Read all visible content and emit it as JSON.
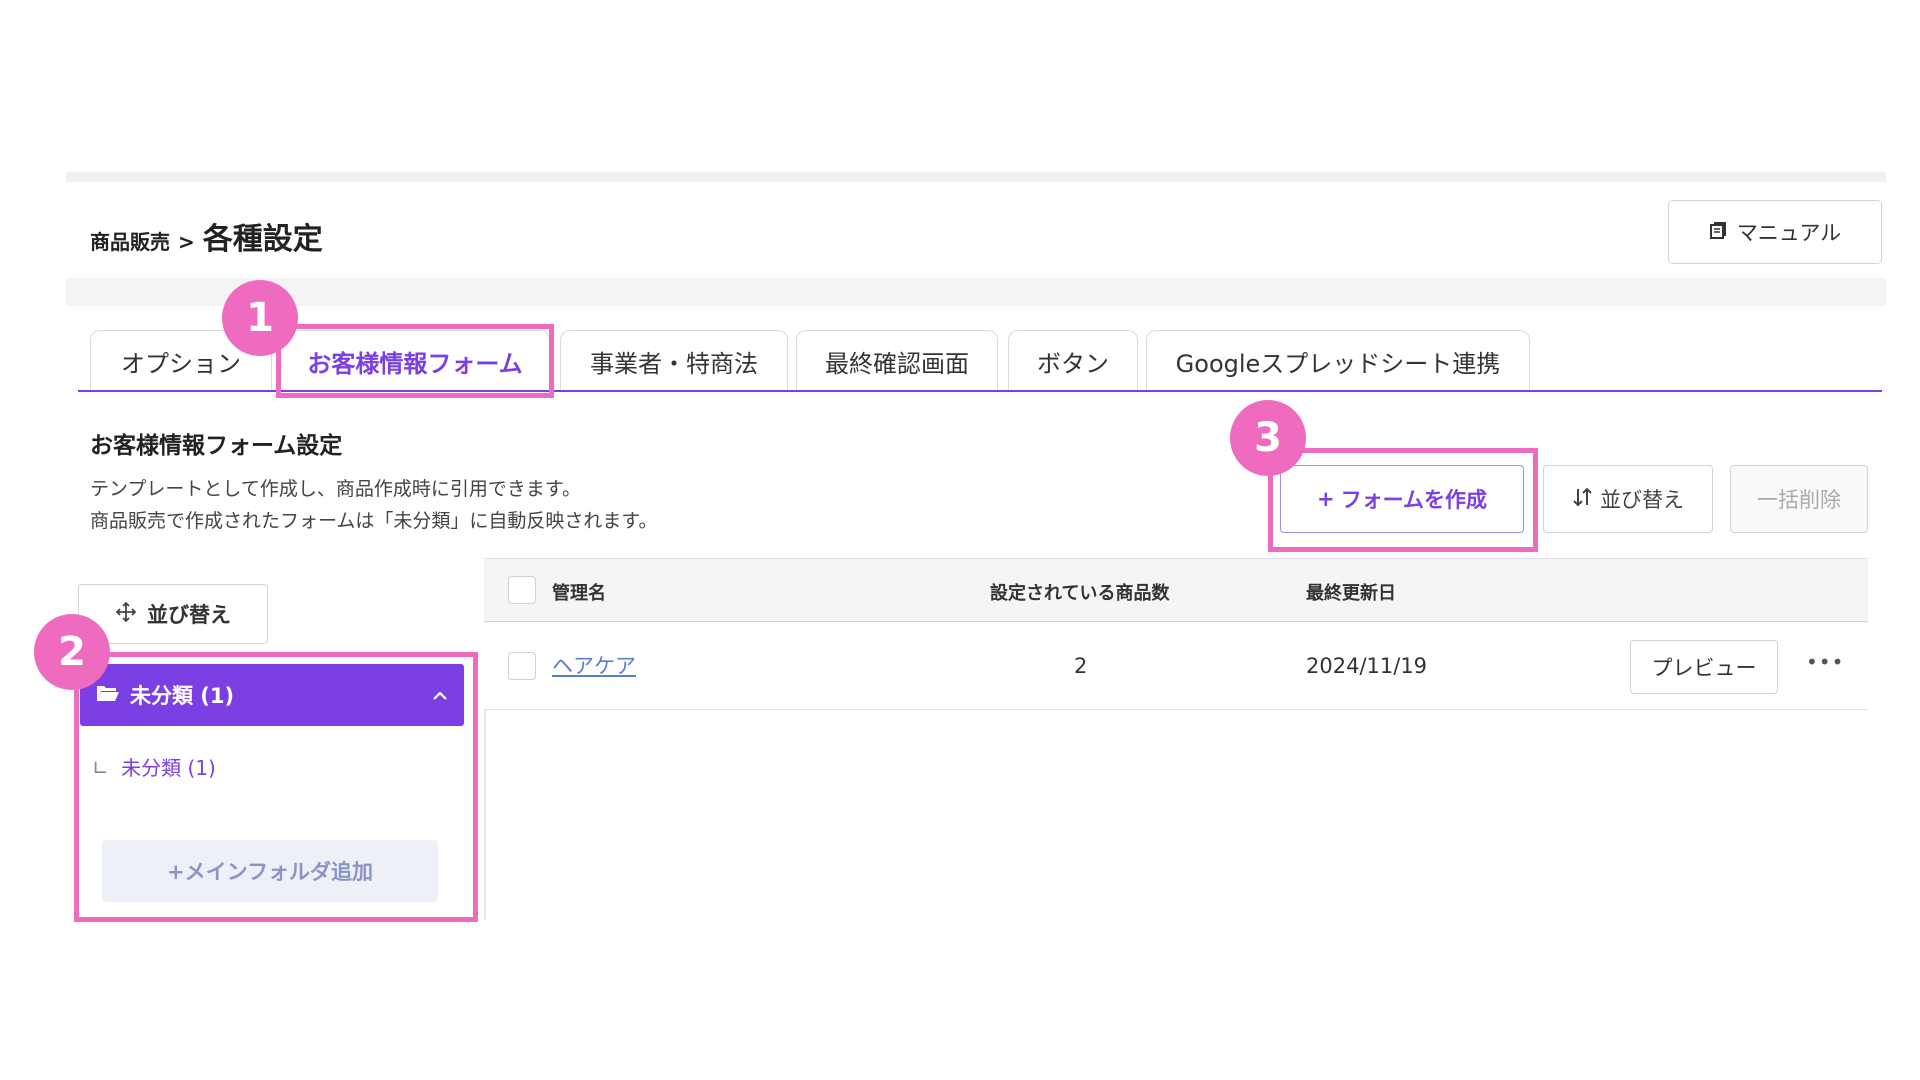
{
  "header": {
    "breadcrumb_parent": "商品販売",
    "breadcrumb_sep": ">",
    "title": "各種設定",
    "manual_label": "マニュアル"
  },
  "tabs": [
    {
      "label": "オプション",
      "active": false
    },
    {
      "label": "お客様情報フォーム",
      "active": true
    },
    {
      "label": "事業者・特商法",
      "active": false
    },
    {
      "label": "最終確認画面",
      "active": false
    },
    {
      "label": "ボタン",
      "active": false
    },
    {
      "label": "Googleスプレッドシート連携",
      "active": false
    }
  ],
  "section": {
    "title": "お客様情報フォーム設定",
    "desc_line1": "テンプレートとして作成し、商品作成時に引用できます。",
    "desc_line2": "商品販売で作成されたフォームは「未分類」に自動反映されます。"
  },
  "actions": {
    "create_label": "フォームを作成",
    "create_plus": "+",
    "sort_label": "並び替え",
    "bulk_delete_label": "一括削除"
  },
  "folders": {
    "sort_label": "並び替え",
    "main_folder_label": "未分類 (1)",
    "sub_folder_prefix": "∟",
    "sub_folder_label": "未分類 (1)",
    "add_folder_label": "+メインフォルダ追加"
  },
  "table": {
    "headers": {
      "name": "管理名",
      "product_count": "設定されている商品数",
      "updated": "最終更新日"
    },
    "rows": [
      {
        "name": "ヘアケア",
        "product_count": "2",
        "updated": "2024/11/19",
        "preview_label": "プレビュー",
        "more_label": "•••"
      }
    ]
  },
  "annotations": {
    "badge1": "1",
    "badge2": "2",
    "badge3": "3",
    "color": "#ee6bc0"
  },
  "colors": {
    "accent": "#7b3fe4",
    "link": "#5a7fd1"
  }
}
